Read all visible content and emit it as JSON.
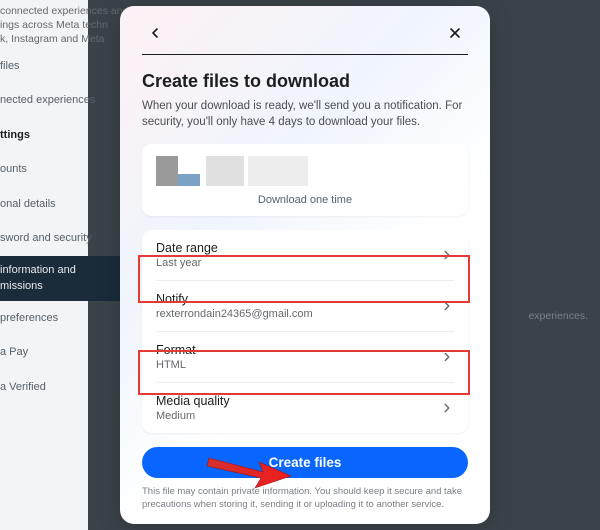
{
  "background": {
    "intro_lines": [
      "connected experiences and",
      "ings across Meta techn",
      "k, Instagram and Meta"
    ],
    "items": [
      {
        "text": "files"
      },
      {
        "text": "nected experiences"
      },
      {
        "text": "ttings",
        "heading": true
      },
      {
        "text": "ounts"
      },
      {
        "text": "onal details"
      },
      {
        "text": "sword and security"
      },
      {
        "text": "information and",
        "sub": "missions",
        "active": true
      },
      {
        "text": "preferences"
      },
      {
        "text": "a Pay"
      },
      {
        "text": "a Verified"
      }
    ],
    "right_text": "experiences."
  },
  "modal": {
    "title": "Create files to download",
    "description": "When your download is ready, we'll send you a notification. For security, you'll only have 4 days to download your files.",
    "preview_caption": "Download one time",
    "options": [
      {
        "key": "date_range",
        "label": "Date range",
        "value": "Last year"
      },
      {
        "key": "notify",
        "label": "Notify",
        "value": "rexterrondain24365@gmail.com"
      },
      {
        "key": "format",
        "label": "Format",
        "value": "HTML"
      },
      {
        "key": "media",
        "label": "Media quality",
        "value": "Medium"
      }
    ],
    "cta": "Create files",
    "footnote": "This file may contain private information. You should keep it secure and take precautions when storing it, sending it or uploading it to another service."
  }
}
